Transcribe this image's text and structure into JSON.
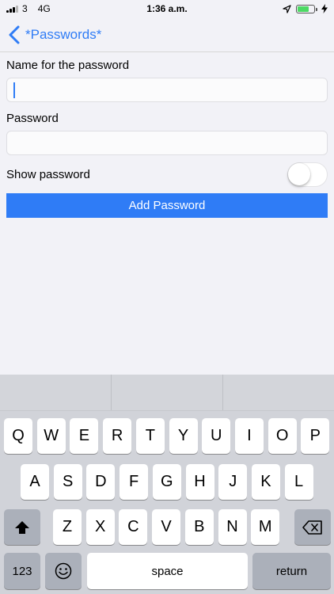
{
  "status_bar": {
    "carrier": "3",
    "network": "4G",
    "time": "1:36 a.m."
  },
  "nav": {
    "back_label": "*Passwords*"
  },
  "form": {
    "name_label": "Name for the password",
    "name_value": "",
    "password_label": "Password",
    "password_value": "",
    "show_password_label": "Show password",
    "show_password_on": false,
    "submit_label": "Add Password"
  },
  "keyboard": {
    "row1": [
      "Q",
      "W",
      "E",
      "R",
      "T",
      "Y",
      "U",
      "I",
      "O",
      "P"
    ],
    "row2": [
      "A",
      "S",
      "D",
      "F",
      "G",
      "H",
      "J",
      "K",
      "L"
    ],
    "row3": [
      "Z",
      "X",
      "C",
      "V",
      "B",
      "N",
      "M"
    ],
    "numbers_label": "123",
    "space_label": "space",
    "return_label": "return"
  },
  "colors": {
    "accent": "#2f7cf6",
    "background": "#f2f2f7",
    "keyboard": "#d1d3d9"
  }
}
